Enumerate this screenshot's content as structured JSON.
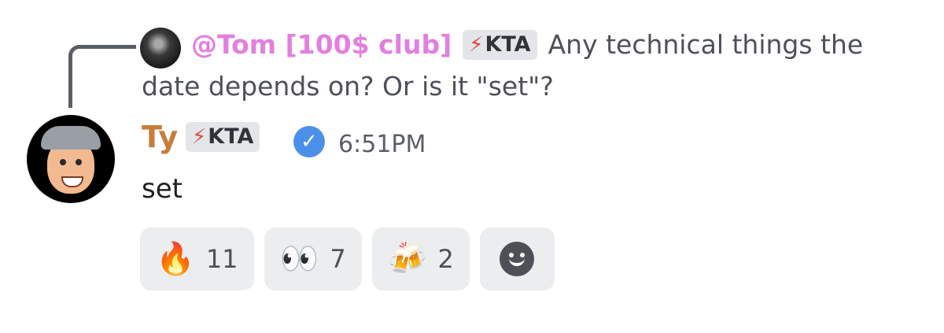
{
  "reply": {
    "mention": "@Tom [100$ club]",
    "tag": "KTA",
    "text_line1": "Any technical things the",
    "text_line2": "date depends on? Or is it \"set\"?"
  },
  "message": {
    "username": "Ty",
    "tag": "KTA",
    "verified_icon": "verified-check-icon",
    "timestamp": "6:51PM",
    "content": "set"
  },
  "reactions": [
    {
      "emoji": "🔥",
      "icon": "fire-emoji",
      "count": "11"
    },
    {
      "emoji": "👀",
      "icon": "eyes-emoji",
      "count": "7"
    },
    {
      "emoji": "🍻",
      "icon": "beers-emoji",
      "count": "2"
    }
  ],
  "colors": {
    "mention": "#e27fdf",
    "username": "#c77d3a",
    "verified": "#4a90e8",
    "reaction_bg": "#ebedef"
  }
}
